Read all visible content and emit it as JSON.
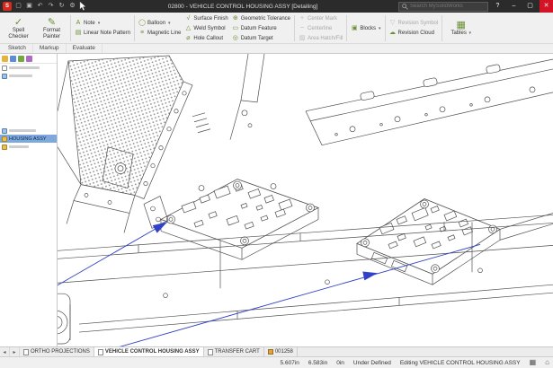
{
  "colors": {
    "leader_blue": "#3242c8",
    "selection_blue": "#7fa8dd",
    "titlebar_bg": "#2b2b2b",
    "close_button_red": "#d41324"
  },
  "titlebar": {
    "title": "02800 - VEHICLE CONTROL HOUSING ASSY [Detailing]",
    "search_placeholder": "Search MySolidWorks",
    "logo_text": "S",
    "icons": [
      {
        "name": "open",
        "glyph": "▢"
      },
      {
        "name": "save",
        "glyph": "▣"
      },
      {
        "name": "undo",
        "glyph": "↶"
      },
      {
        "name": "redo",
        "glyph": "↷"
      },
      {
        "name": "rebuild",
        "glyph": "↻"
      },
      {
        "name": "options",
        "glyph": "⚙"
      }
    ],
    "window": {
      "min": "–",
      "max": "▢",
      "close": "✕",
      "help": "?"
    }
  },
  "ribbon": {
    "dropdown_glyph": "▾",
    "tabs": [
      {
        "label": "Sketch"
      },
      {
        "label": "Markup"
      },
      {
        "label": "Evaluate"
      }
    ],
    "buttons": {
      "spell_checker": {
        "line1": "Spell",
        "line2": "Checker",
        "glyph": "✓"
      },
      "format_painter": {
        "line1": "Format",
        "line2": "Painter",
        "glyph": "✎"
      },
      "note": {
        "label": "Note",
        "glyph": "A"
      },
      "linear_note_pattern": {
        "label": "Linear Note Pattern",
        "glyph": "▤"
      },
      "balloon": {
        "label": "Balloon",
        "glyph": "◯"
      },
      "magnetic_line": {
        "label": "Magnetic Line",
        "glyph": "≡"
      },
      "surface_finish": {
        "label": "Surface Finish",
        "glyph": "√"
      },
      "weld_symbol": {
        "label": "Weld Symbol",
        "glyph": "△"
      },
      "hole_callout": {
        "label": "Hole Callout",
        "glyph": "⌀"
      },
      "geometric_tolerance": {
        "label": "Geometric Tolerance",
        "glyph": "⊕"
      },
      "datum_feature": {
        "label": "Datum Feature",
        "glyph": "▭"
      },
      "datum_target": {
        "label": "Datum Target",
        "glyph": "◎"
      },
      "center_mark": {
        "label": "Center Mark",
        "glyph": "+"
      },
      "centerline": {
        "label": "Centerline",
        "glyph": "╌"
      },
      "area_hatch": {
        "label": "Area Hatch/Fill",
        "glyph": "▨"
      },
      "blocks": {
        "label": "Blocks",
        "glyph": "▣"
      },
      "revision_symbol": {
        "label": "Revision Symbol",
        "glyph": "▽"
      },
      "revision_cloud": {
        "label": "Revision Cloud",
        "glyph": "☁"
      },
      "tables": {
        "label": "Tables",
        "glyph": "▦"
      }
    }
  },
  "feature_tree": {
    "selected_item": "HOUSING ASSY"
  },
  "sheet_tabs": {
    "nav_prev": "◂",
    "nav_next": "▸",
    "tabs": [
      {
        "label": "ORTHO PROJECTIONS"
      },
      {
        "label": "VEHICLE CONTROL HOUSING ASSY"
      },
      {
        "label": "TRANSFER CART"
      },
      {
        "label": "001258"
      }
    ]
  },
  "statusbar": {
    "x": "5.607in",
    "y": "6.583in",
    "z": "0in",
    "state": "Under Defined",
    "editing": "Editing VEHICLE CONTROL HOUSING ASSY",
    "icons": [
      {
        "name": "pane-toggle",
        "glyph": "▦"
      },
      {
        "name": "home",
        "glyph": "⌂"
      }
    ]
  }
}
